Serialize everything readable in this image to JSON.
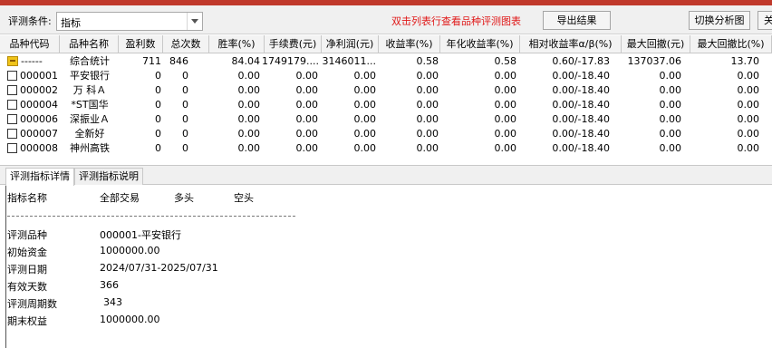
{
  "toolbar": {
    "condition_label": "评测条件:",
    "condition_value": "指标",
    "hint": "双击列表行查看品种评测图表",
    "export_label": "导出结果",
    "switch_label": "切换分析图",
    "close_label": "关闭",
    "hint_color": "#e01818"
  },
  "table": {
    "headers": [
      "品种代码",
      "品种名称",
      "盈利数",
      "总次数",
      "胜率(%)",
      "手续费(元)",
      "净利润(元)",
      "收益率(%)",
      "年化收益率(%)",
      "相对收益率α/β(%)",
      "最大回撤(元)",
      "最大回撤比(%)"
    ],
    "rows": [
      {
        "icon": "summary-folder-icon",
        "code": "------",
        "name": "综合统计",
        "wins": "711",
        "total": "846",
        "winrate": "84.04",
        "fee": "1749179....",
        "profit": "3146011...",
        "ret": "0.58",
        "annual": "0.58",
        "rel": "0.60/-17.83",
        "maxdd": "137037.06",
        "maxddr": "13.70"
      },
      {
        "icon": "checkbox-icon",
        "code": "000001",
        "name": "平安银行",
        "wins": "0",
        "total": "0",
        "winrate": "0.00",
        "fee": "0.00",
        "profit": "0.00",
        "ret": "0.00",
        "annual": "0.00",
        "rel": "0.00/-18.40",
        "maxdd": "0.00",
        "maxddr": "0.00"
      },
      {
        "icon": "checkbox-icon",
        "code": "000002",
        "name": "万 科Ａ",
        "wins": "0",
        "total": "0",
        "winrate": "0.00",
        "fee": "0.00",
        "profit": "0.00",
        "ret": "0.00",
        "annual": "0.00",
        "rel": "0.00/-18.40",
        "maxdd": "0.00",
        "maxddr": "0.00"
      },
      {
        "icon": "checkbox-icon",
        "code": "000004",
        "name": "*ST国华",
        "wins": "0",
        "total": "0",
        "winrate": "0.00",
        "fee": "0.00",
        "profit": "0.00",
        "ret": "0.00",
        "annual": "0.00",
        "rel": "0.00/-18.40",
        "maxdd": "0.00",
        "maxddr": "0.00"
      },
      {
        "icon": "checkbox-icon",
        "code": "000006",
        "name": "深振业Ａ",
        "wins": "0",
        "total": "0",
        "winrate": "0.00",
        "fee": "0.00",
        "profit": "0.00",
        "ret": "0.00",
        "annual": "0.00",
        "rel": "0.00/-18.40",
        "maxdd": "0.00",
        "maxddr": "0.00"
      },
      {
        "icon": "checkbox-icon",
        "code": "000007",
        "name": "全新好",
        "wins": "0",
        "total": "0",
        "winrate": "0.00",
        "fee": "0.00",
        "profit": "0.00",
        "ret": "0.00",
        "annual": "0.00",
        "rel": "0.00/-18.40",
        "maxdd": "0.00",
        "maxddr": "0.00"
      },
      {
        "icon": "checkbox-icon",
        "code": "000008",
        "name": "神州高铁",
        "wins": "0",
        "total": "0",
        "winrate": "0.00",
        "fee": "0.00",
        "profit": "0.00",
        "ret": "0.00",
        "annual": "0.00",
        "rel": "0.00/-18.40",
        "maxdd": "0.00",
        "maxddr": "0.00"
      }
    ]
  },
  "tabs": [
    "评测指标详情",
    "评测指标说明"
  ],
  "detail": {
    "headers": [
      "指标名称",
      "全部交易",
      "多头",
      "空头"
    ],
    "items": [
      {
        "label": "评测品种",
        "value": "000001-平安银行"
      },
      {
        "label": "初始资金",
        "value": "1000000.00"
      },
      {
        "label": "评测日期",
        "value": "2024/07/31-2025/07/31"
      },
      {
        "label": "有效天数",
        "value": "366"
      },
      {
        "label": "评测周期数",
        "value": "343"
      },
      {
        "label": "期末权益",
        "value": "1000000.00"
      }
    ]
  }
}
